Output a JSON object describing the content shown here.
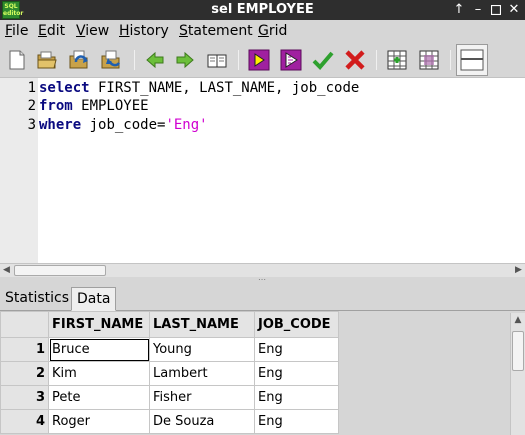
{
  "window": {
    "app_icon_label": "SQL editor",
    "title": "sel EMPLOYEE",
    "controls": [
      "up-arrow-icon",
      "minimize-icon",
      "maximize-icon",
      "close-icon"
    ]
  },
  "menu": {
    "items": [
      {
        "label": "File",
        "mnemonic": "F"
      },
      {
        "label": "Edit",
        "mnemonic": "E"
      },
      {
        "label": "View",
        "mnemonic": "V"
      },
      {
        "label": "History",
        "mnemonic": "H"
      },
      {
        "label": "Statement",
        "mnemonic": "S"
      },
      {
        "label": "Grid",
        "mnemonic": "G"
      }
    ]
  },
  "toolbar": {
    "icons": [
      "new-file-icon",
      "open-folder-icon",
      "load-icon",
      "save-icon",
      "back-arrow-icon",
      "forward-arrow-icon",
      "book-icon",
      "run-icon",
      "run-selected-icon",
      "commit-icon",
      "rollback-icon",
      "grid-add-icon",
      "grid-remove-icon",
      "layout-toggle-icon"
    ]
  },
  "editor": {
    "line_numbers": [
      "1",
      "2",
      "3"
    ],
    "lines": [
      {
        "keyword": "select",
        "rest": " FIRST_NAME, LAST_NAME, job_code",
        "string": ""
      },
      {
        "keyword": "from",
        "rest": " EMPLOYEE",
        "string": ""
      },
      {
        "keyword": "where",
        "rest": " job_code=",
        "string": "'Eng'"
      }
    ],
    "colors": {
      "keyword": "#0a0a80",
      "string": "#d000d0"
    }
  },
  "tabs": [
    {
      "label": "Statistics",
      "active": false
    },
    {
      "label": "Data",
      "active": true
    }
  ],
  "grid": {
    "columns": [
      "FIRST_NAME",
      "LAST_NAME",
      "JOB_CODE"
    ],
    "rows": [
      {
        "num": "1",
        "cells": [
          "Bruce",
          "Young",
          "Eng"
        ]
      },
      {
        "num": "2",
        "cells": [
          "Kim",
          "Lambert",
          "Eng"
        ]
      },
      {
        "num": "3",
        "cells": [
          "Pete",
          "Fisher",
          "Eng"
        ]
      },
      {
        "num": "4",
        "cells": [
          "Roger",
          "De Souza",
          "Eng"
        ]
      }
    ]
  }
}
